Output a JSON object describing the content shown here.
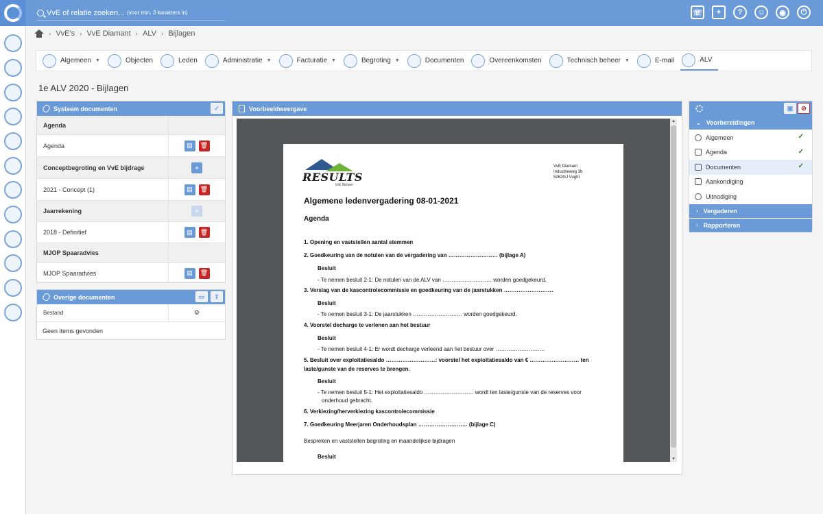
{
  "search": {
    "placeholder": "VvE of relatie zoeken...",
    "hint": "(voor min. 3 karakters in)"
  },
  "top_icons": [
    "phone-icon",
    "notes-icon",
    "help-icon",
    "support-icon",
    "settings-icon",
    "logout-icon"
  ],
  "breadcrumb": [
    "VvE's",
    "VvE Diamant",
    "ALV",
    "Bijlagen"
  ],
  "tabs": [
    {
      "label": "Algemeen",
      "caret": true
    },
    {
      "label": "Objecten",
      "caret": false
    },
    {
      "label": "Leden",
      "caret": false
    },
    {
      "label": "Administratie",
      "caret": true
    },
    {
      "label": "Facturatie",
      "caret": true
    },
    {
      "label": "Begroting",
      "caret": true
    },
    {
      "label": "Documenten",
      "caret": false
    },
    {
      "label": "Overeenkomsten",
      "caret": false
    },
    {
      "label": "Technisch beheer",
      "caret": true
    },
    {
      "label": "E-mail",
      "caret": false
    },
    {
      "label": "ALV",
      "caret": false
    }
  ],
  "page_title": "1e ALV 2020 - Bijlagen",
  "system_docs": {
    "title": "Systeem documenten",
    "rows": [
      {
        "type": "group",
        "label": "Agenda"
      },
      {
        "type": "item",
        "label": "Agenda"
      },
      {
        "type": "group",
        "label": "Conceptbegroting en VvE bijdrage"
      },
      {
        "type": "item",
        "label": "2021 - Concept (1)"
      },
      {
        "type": "group",
        "label": "Jaarrekening"
      },
      {
        "type": "item",
        "label": "2018 - Definitief"
      },
      {
        "type": "group",
        "label": "MJOP Spaaradvies"
      },
      {
        "type": "item",
        "label": "MJOP Spaaradvies"
      }
    ]
  },
  "other_docs": {
    "title": "Overige documenten",
    "column": "Bestand",
    "empty": "Geen items gevonden"
  },
  "preview": {
    "title": "Voorbeeldweergave",
    "doc": {
      "logo_word": "RESULTS",
      "logo_sub": "VvE Beheer",
      "address": [
        "VvE Diamant",
        "Industrieweg 3b",
        "5262GJ Vught"
      ],
      "heading": "Algemene ledenvergadering 08-01-2021",
      "subheading": "Agenda",
      "lines": [
        "1. Opening en vaststellen aantal stemmen",
        "2. Goedkeuring van de notulen van de vergadering van ……………………… (bijlage A)",
        "Besluit",
        "- Te nemen besluit 2-1: De notulen van de ALV van ……………………… worden goedgekeurd.",
        "3. Verslag van de kascontrolecommissie en goedkeuring van de jaarstukken ………………………",
        "Besluit",
        "- Te nemen besluit 3-1: De jaarstukken ……………………… worden goedgekeurd.",
        "4. Voorstel decharge te verlenen aan het bestuur",
        "Besluit",
        "- Te nemen besluit 4-1: Er wordt decharge verleend aan het bestuur over ………………………",
        "5. Besluit over exploitatiesaldo ………………………: voorstel het exploitatiesaldo van € ……………………… ten",
        "laste/gunste van de reserves te brengen.",
        "Besluit",
        "- Te nemen besluit 5-1: Het exploitatiesaldo ……………………… wordt ten laste/gunste van de reserves voor",
        "onderhoud gebracht.",
        "6. Verkiezing/herverkiezing kascontrolecommissie",
        "7. Goedkeuring Meerjaren Onderhoudsplan ……………………… (bijlage C)",
        "Bespreken en vaststellen begroting en maandelijkse bijdragen",
        "Besluit"
      ]
    }
  },
  "workflow": {
    "sections": [
      {
        "label": "Voorbereidingen",
        "expanded": true
      },
      {
        "label": "Vergaderen",
        "expanded": false
      },
      {
        "label": "Rapporteren",
        "expanded": false
      }
    ],
    "steps": [
      {
        "label": "Algemeen",
        "done": true,
        "icon": "info-icon"
      },
      {
        "label": "Agenda",
        "done": true,
        "icon": "calendar-icon"
      },
      {
        "label": "Documenten",
        "done": true,
        "icon": "documents-icon"
      },
      {
        "label": "Aankondiging",
        "done": false,
        "icon": "megaphone-icon"
      },
      {
        "label": "Uitnodiging",
        "done": false,
        "icon": "chat-icon"
      }
    ]
  },
  "colors": {
    "primary": "#6a9ad8",
    "danger": "#c62828",
    "success": "#3a7d2e"
  }
}
